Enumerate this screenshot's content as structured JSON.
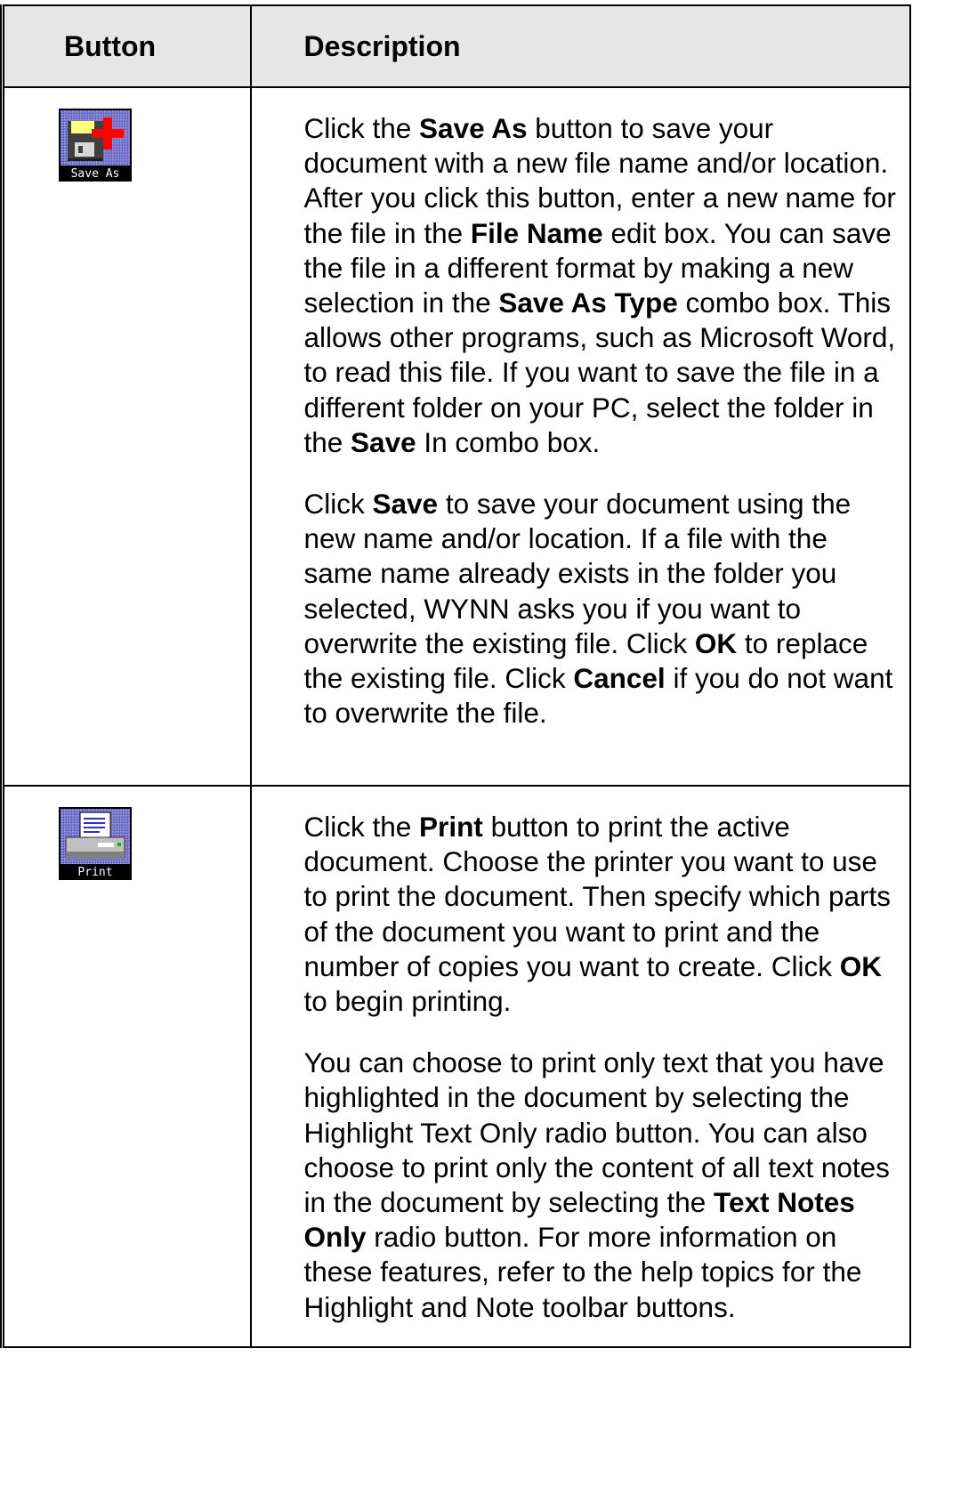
{
  "table": {
    "headers": {
      "button": "Button",
      "description": "Description"
    },
    "rows": [
      {
        "icon": "save-as-icon",
        "icon_label": "Save As",
        "paragraphs": [
          [
            {
              "t": "Click the "
            },
            {
              "t": "Save As",
              "b": true
            },
            {
              "t": " button to save your document with a new file name and/or location. After you click this button, enter a new name for the file in the "
            },
            {
              "t": "File Name",
              "b": true
            },
            {
              "t": " edit box. You can save the file in a different format by making a new selection in the "
            },
            {
              "t": "Save As Type",
              "b": true
            },
            {
              "t": " combo box. This allows other programs, such as Microsoft Word, to read this file. If you want to save the file in a different folder on your PC, select the folder in the "
            },
            {
              "t": "Save",
              "b": true
            },
            {
              "t": " In combo box."
            }
          ],
          [
            {
              "t": "Click "
            },
            {
              "t": "Save",
              "b": true
            },
            {
              "t": " to save your document using the new name and/or location. If a file with the same name already exists in the folder you selected, WYNN asks you if you want to overwrite the existing file. Click "
            },
            {
              "t": "OK",
              "b": true
            },
            {
              "t": " to replace the existing file. Click "
            },
            {
              "t": "Cancel",
              "b": true
            },
            {
              "t": " if you do not want to overwrite the file."
            }
          ]
        ]
      },
      {
        "icon": "print-icon",
        "icon_label": "Print",
        "paragraphs": [
          [
            {
              "t": "Click the "
            },
            {
              "t": "Print",
              "b": true
            },
            {
              "t": " button to print the active document. Choose the printer you want to use to print the document. Then specify which parts of the document you want to print and the number of copies you want to create. Click "
            },
            {
              "t": "OK",
              "b": true
            },
            {
              "t": " to begin printing."
            }
          ],
          [
            {
              "t": "You can choose to print only text that you have highlighted in the document by selecting the Highlight Text Only radio button. You can also choose to print only the content of all text notes in the document by selecting the "
            },
            {
              "t": "Text Notes Only",
              "b": true
            },
            {
              "t": " radio button. For more information on these features, refer to the help topics for the Highlight and Note toolbar buttons."
            }
          ]
        ]
      }
    ]
  },
  "colors": {
    "header_bg": "#e6e6e6",
    "icon_bg": "#7878c8",
    "icon_accent_red": "#ff0000"
  }
}
